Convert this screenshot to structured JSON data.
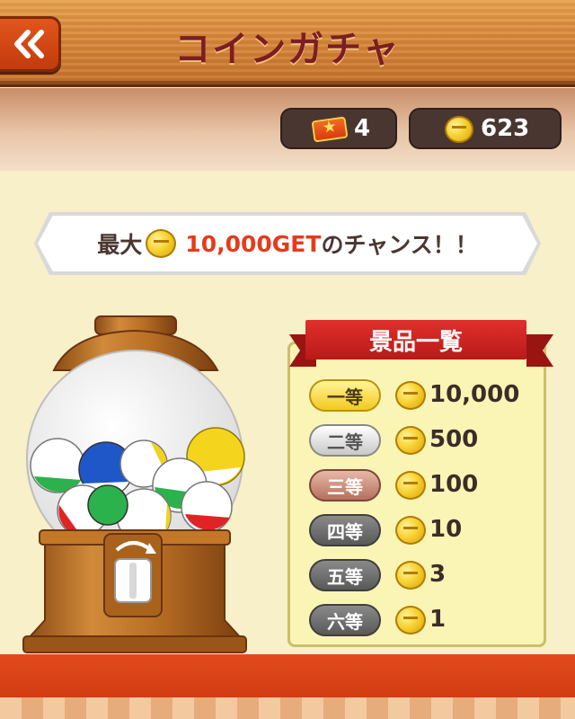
{
  "header": {
    "title": "コインガチャ",
    "back_icon": "double-chevron-left-icon"
  },
  "currency": {
    "tickets": "4",
    "coins": "623",
    "ticket_icon": "ticket-icon",
    "coin_icon": "coin-icon"
  },
  "banner": {
    "prefix": "最大",
    "amount": "10,000",
    "get": "GET",
    "suffix": "のチャンス！！"
  },
  "prize_list": {
    "title": "景品一覧",
    "items": [
      {
        "rank": "一等",
        "value": "10,000",
        "style": "gold"
      },
      {
        "rank": "二等",
        "value": "500",
        "style": "silver"
      },
      {
        "rank": "三等",
        "value": "100",
        "style": "bronze"
      },
      {
        "rank": "四等",
        "value": "10",
        "style": "gray"
      },
      {
        "rank": "五等",
        "value": "3",
        "style": "gray"
      },
      {
        "rank": "六等",
        "value": "1",
        "style": "gray"
      }
    ]
  },
  "colors": {
    "header_wood": "#d9893a",
    "back_button": "#d9481a",
    "title_text": "#7a1e24",
    "banner_amount": "#e53b1b",
    "ribbon": "#d42a25",
    "panel": "#fbf5b5",
    "bottom_band": "#e24a1c"
  }
}
